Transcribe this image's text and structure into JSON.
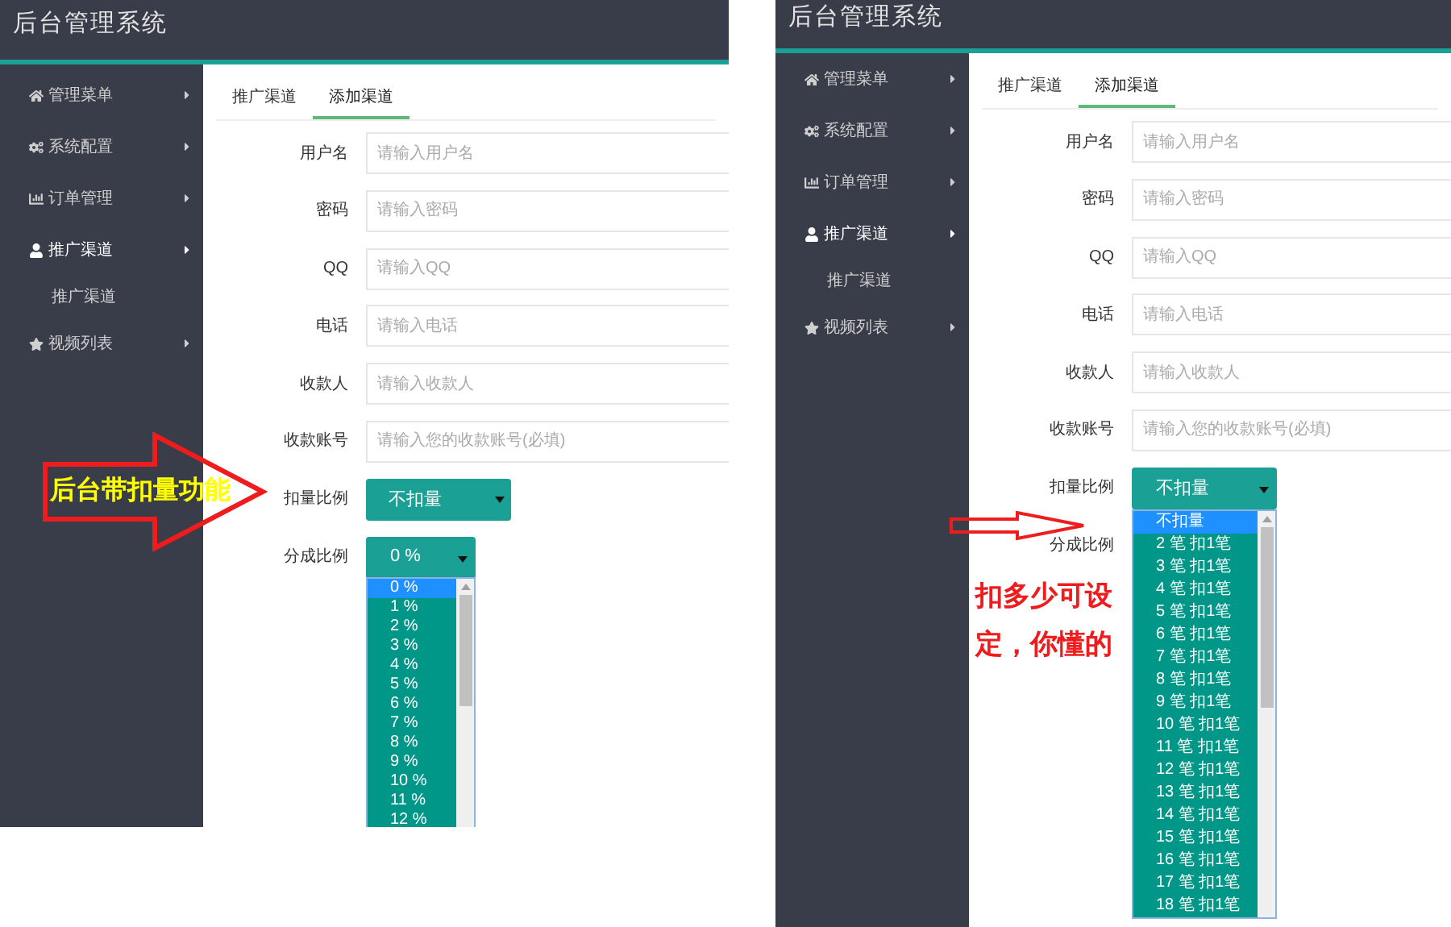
{
  "screens": [
    {
      "title": "后台管理系统",
      "menu": [
        {
          "label": "管理菜单",
          "expanded": false
        },
        {
          "label": "系统配置",
          "expanded": false
        },
        {
          "label": "订单管理",
          "expanded": false
        },
        {
          "label": "推广渠道",
          "expanded": true,
          "children": [
            {
              "label": "推广渠道"
            }
          ]
        },
        {
          "label": "视频列表",
          "expanded": false
        }
      ],
      "tabs": [
        {
          "label": "推广渠道",
          "selected": false
        },
        {
          "label": "添加渠道",
          "selected": true
        }
      ],
      "fields": [
        {
          "kind": "input",
          "label": "用户名",
          "placeholder": "请输入用户名"
        },
        {
          "kind": "input",
          "label": "密码",
          "placeholder": "请输入密码"
        },
        {
          "kind": "input",
          "label": "QQ",
          "placeholder": "请输入QQ"
        },
        {
          "kind": "input",
          "label": "电话",
          "placeholder": "请输入电话"
        },
        {
          "kind": "input",
          "label": "收款人",
          "placeholder": "请输入收款人"
        },
        {
          "kind": "input",
          "label": "收款账号",
          "placeholder": "请输入您的收款账号(必填)"
        },
        {
          "kind": "select",
          "label": "扣量比例",
          "value": "不扣量",
          "expanded": false
        },
        {
          "kind": "select",
          "label": "分成比例",
          "value": "0 %",
          "expanded": true,
          "options": [
            {
              "label": "0 %",
              "selected": true
            },
            {
              "label": "1 %",
              "selected": false
            },
            {
              "label": "2 %",
              "selected": false
            },
            {
              "label": "3 %",
              "selected": false
            },
            {
              "label": "4 %",
              "selected": false
            },
            {
              "label": "5 %",
              "selected": false
            },
            {
              "label": "6 %",
              "selected": false
            },
            {
              "label": "7 %",
              "selected": false
            },
            {
              "label": "8 %",
              "selected": false
            },
            {
              "label": "9 %",
              "selected": false
            },
            {
              "label": "10 %",
              "selected": false
            },
            {
              "label": "11 %",
              "selected": false
            },
            {
              "label": "12 %",
              "selected": false
            }
          ]
        }
      ],
      "annotations": [
        {
          "kind": "block-arrow",
          "text": "后台带扣量功能"
        }
      ]
    },
    {
      "title": "后台管理系统",
      "menu": [
        {
          "label": "管理菜单",
          "expanded": false
        },
        {
          "label": "系统配置",
          "expanded": false
        },
        {
          "label": "订单管理",
          "expanded": false
        },
        {
          "label": "推广渠道",
          "expanded": true,
          "children": [
            {
              "label": "推广渠道"
            }
          ]
        },
        {
          "label": "视频列表",
          "expanded": false
        }
      ],
      "tabs": [
        {
          "label": "推广渠道",
          "selected": false
        },
        {
          "label": "添加渠道",
          "selected": true
        }
      ],
      "fields": [
        {
          "kind": "input",
          "label": "用户名",
          "placeholder": "请输入用户名"
        },
        {
          "kind": "input",
          "label": "密码",
          "placeholder": "请输入密码"
        },
        {
          "kind": "input",
          "label": "QQ",
          "placeholder": "请输入QQ"
        },
        {
          "kind": "input",
          "label": "电话",
          "placeholder": "请输入电话"
        },
        {
          "kind": "input",
          "label": "收款人",
          "placeholder": "请输入收款人"
        },
        {
          "kind": "input",
          "label": "收款账号",
          "placeholder": "请输入您的收款账号(必填)"
        },
        {
          "kind": "select",
          "label": "扣量比例",
          "value": "不扣量",
          "expanded": true,
          "options": [
            {
              "label": "不扣量",
              "selected": true
            },
            {
              "label": "2 笔 扣1笔",
              "selected": false
            },
            {
              "label": "3 笔 扣1笔",
              "selected": false
            },
            {
              "label": "4 笔 扣1笔",
              "selected": false
            },
            {
              "label": "5 笔 扣1笔",
              "selected": false
            },
            {
              "label": "6 笔 扣1笔",
              "selected": false
            },
            {
              "label": "7 笔 扣1笔",
              "selected": false
            },
            {
              "label": "8 笔 扣1笔",
              "selected": false
            },
            {
              "label": "9 笔 扣1笔",
              "selected": false
            },
            {
              "label": "10 笔 扣1笔",
              "selected": false
            },
            {
              "label": "11 笔 扣1笔",
              "selected": false
            },
            {
              "label": "12 笔 扣1笔",
              "selected": false
            },
            {
              "label": "13 笔 扣1笔",
              "selected": false
            },
            {
              "label": "14 笔 扣1笔",
              "selected": false
            },
            {
              "label": "15 笔 扣1笔",
              "selected": false
            },
            {
              "label": "16 笔 扣1笔",
              "selected": false
            },
            {
              "label": "17 笔 扣1笔",
              "selected": false
            },
            {
              "label": "18 笔 扣1笔",
              "selected": false
            }
          ]
        },
        {
          "kind": "select",
          "label": "分成比例"
        }
      ],
      "annotations": [
        {
          "kind": "thin-arrow"
        },
        {
          "kind": "note",
          "text": "扣多少可设定，你懂的"
        }
      ]
    }
  ]
}
